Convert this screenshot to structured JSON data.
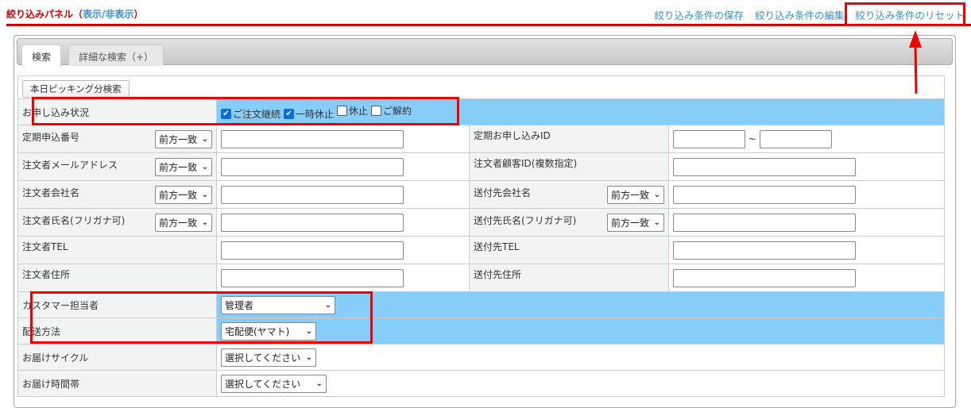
{
  "header": {
    "title": "絞り込みパネル",
    "toggle_open": "（",
    "toggle_link": "表示/非表示",
    "toggle_close": "）",
    "links": [
      "絞り込み条件の保存",
      "絞り込み条件の編集",
      "絞り込み条件のリセット"
    ]
  },
  "tabs": [
    "検索",
    "詳細な検索（+）"
  ],
  "picking_button": "本日ピッキング分検索",
  "status": {
    "label": "お申し込み状況",
    "options": [
      {
        "label": "ご注文継続",
        "checked": true
      },
      {
        "label": "一時休止",
        "checked": true
      },
      {
        "label": "休止",
        "checked": false
      },
      {
        "label": "ご解約",
        "checked": false
      }
    ]
  },
  "match_mode": "前方一致",
  "rows": [
    {
      "left": "定期申込番号",
      "right": "定期お申し込みID",
      "range_sep": "~"
    },
    {
      "left": "注文者メールアドレス",
      "right": "注文者顧客ID(複数指定)"
    },
    {
      "left": "注文者会社名",
      "right": "送付先会社名"
    },
    {
      "left": "注文者氏名(フリガナ可)",
      "right": "送付先氏名(フリガナ可)"
    },
    {
      "left": "注文者TEL",
      "right": "送付先TEL"
    },
    {
      "left": "注文者住所",
      "right": "送付先住所"
    }
  ],
  "selects": [
    {
      "label": "カスタマー担当者",
      "value": "管理者"
    },
    {
      "label": "配送方法",
      "value": "宅配便(ヤマト)"
    },
    {
      "label": "お届けサイクル",
      "value": "選択してください"
    },
    {
      "label": "お届け時間帯",
      "value": "選択してください"
    }
  ],
  "colors": {
    "accent": "#cc0000",
    "link": "#3a8fd0",
    "highlight": "#87cdf9"
  }
}
